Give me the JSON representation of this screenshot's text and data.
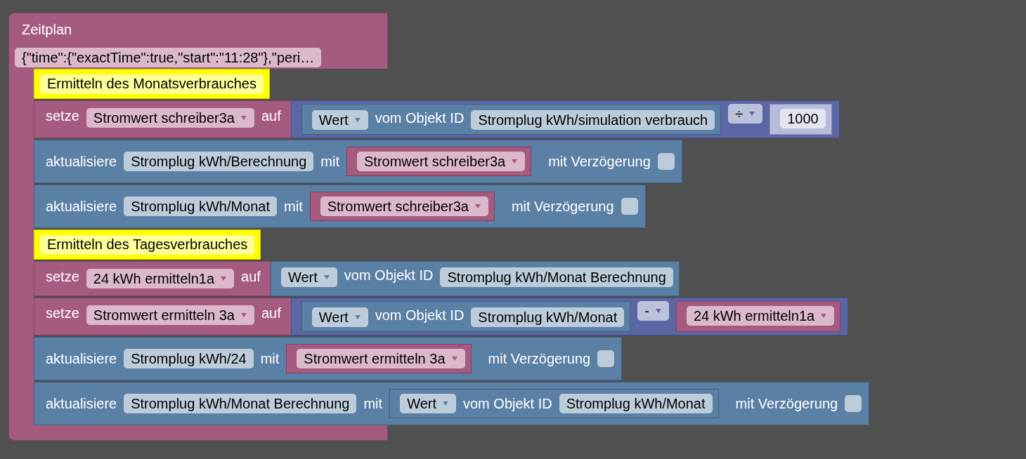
{
  "workspace": {
    "block": {
      "title": "Zeitplan",
      "schedule": "{\"time\":{\"exactTime\":true,\"start\":\"11:28\"},\"peri…",
      "statements": [
        {
          "kind": "comment",
          "text": "Ermitteln des Monatsverbrauches"
        },
        {
          "kind": "set",
          "label": "setze",
          "variable": "Stromwert schreiber3a",
          "to_label": "auf",
          "value": {
            "kind": "math",
            "left": {
              "kind": "get_value",
              "property": "Wert",
              "label": "vom Objekt ID",
              "object": "Stromplug kWh/simulation verbrauch"
            },
            "operator": "÷",
            "right": {
              "kind": "number",
              "value": "1000"
            }
          }
        },
        {
          "kind": "update",
          "label": "aktualisiere",
          "object": "Stromplug kWh/Berechnung",
          "with_label": "mit",
          "value": {
            "kind": "variable",
            "name": "Stromwert schreiber3a"
          },
          "delay_label": "mit Verzögerung",
          "delay_checked": false
        },
        {
          "kind": "update",
          "label": "aktualisiere",
          "object": "Stromplug kWh/Monat",
          "with_label": "mit",
          "value": {
            "kind": "variable",
            "name": "Stromwert schreiber3a"
          },
          "delay_label": "mit Verzögerung",
          "delay_checked": false
        },
        {
          "kind": "comment",
          "text": "Ermitteln des Tagesverbrauches"
        },
        {
          "kind": "set",
          "label": "setze",
          "variable": "24 kWh ermitteln1a",
          "to_label": "auf",
          "value": {
            "kind": "get_value",
            "property": "Wert",
            "label": "vom Objekt ID",
            "object": "Stromplug kWh/Monat Berechnung"
          }
        },
        {
          "kind": "set",
          "label": "setze",
          "variable": "Stromwert ermitteln 3a",
          "to_label": "auf",
          "value": {
            "kind": "math",
            "left": {
              "kind": "get_value",
              "property": "Wert",
              "label": "vom Objekt ID",
              "object": "Stromplug kWh/Monat"
            },
            "operator": "-",
            "right": {
              "kind": "variable",
              "name": "24 kWh ermitteln1a"
            }
          }
        },
        {
          "kind": "update",
          "label": "aktualisiere",
          "object": "Stromplug kWh/24",
          "with_label": "mit",
          "value": {
            "kind": "variable",
            "name": "Stromwert ermitteln 3a"
          },
          "delay_label": "mit Verzögerung",
          "delay_checked": false
        },
        {
          "kind": "update",
          "label": "aktualisiere",
          "object": "Stromplug kWh/Monat Berechnung",
          "with_label": "mit",
          "value": {
            "kind": "get_value",
            "property": "Wert",
            "label": "vom Objekt ID",
            "object": "Stromplug kWh/Monat"
          },
          "delay_label": "mit Verzögerung",
          "delay_checked": false
        }
      ]
    }
  }
}
